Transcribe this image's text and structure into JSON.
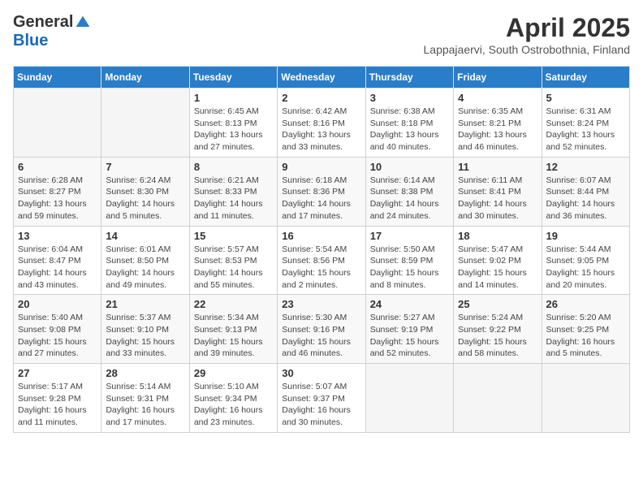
{
  "header": {
    "logo_general": "General",
    "logo_blue": "Blue",
    "month": "April 2025",
    "location": "Lappajaervi, South Ostrobothnia, Finland"
  },
  "weekdays": [
    "Sunday",
    "Monday",
    "Tuesday",
    "Wednesday",
    "Thursday",
    "Friday",
    "Saturday"
  ],
  "weeks": [
    [
      {
        "day": "",
        "info": ""
      },
      {
        "day": "",
        "info": ""
      },
      {
        "day": "1",
        "info": "Sunrise: 6:45 AM\nSunset: 8:13 PM\nDaylight: 13 hours and 27 minutes."
      },
      {
        "day": "2",
        "info": "Sunrise: 6:42 AM\nSunset: 8:16 PM\nDaylight: 13 hours and 33 minutes."
      },
      {
        "day": "3",
        "info": "Sunrise: 6:38 AM\nSunset: 8:18 PM\nDaylight: 13 hours and 40 minutes."
      },
      {
        "day": "4",
        "info": "Sunrise: 6:35 AM\nSunset: 8:21 PM\nDaylight: 13 hours and 46 minutes."
      },
      {
        "day": "5",
        "info": "Sunrise: 6:31 AM\nSunset: 8:24 PM\nDaylight: 13 hours and 52 minutes."
      }
    ],
    [
      {
        "day": "6",
        "info": "Sunrise: 6:28 AM\nSunset: 8:27 PM\nDaylight: 13 hours and 59 minutes."
      },
      {
        "day": "7",
        "info": "Sunrise: 6:24 AM\nSunset: 8:30 PM\nDaylight: 14 hours and 5 minutes."
      },
      {
        "day": "8",
        "info": "Sunrise: 6:21 AM\nSunset: 8:33 PM\nDaylight: 14 hours and 11 minutes."
      },
      {
        "day": "9",
        "info": "Sunrise: 6:18 AM\nSunset: 8:36 PM\nDaylight: 14 hours and 17 minutes."
      },
      {
        "day": "10",
        "info": "Sunrise: 6:14 AM\nSunset: 8:38 PM\nDaylight: 14 hours and 24 minutes."
      },
      {
        "day": "11",
        "info": "Sunrise: 6:11 AM\nSunset: 8:41 PM\nDaylight: 14 hours and 30 minutes."
      },
      {
        "day": "12",
        "info": "Sunrise: 6:07 AM\nSunset: 8:44 PM\nDaylight: 14 hours and 36 minutes."
      }
    ],
    [
      {
        "day": "13",
        "info": "Sunrise: 6:04 AM\nSunset: 8:47 PM\nDaylight: 14 hours and 43 minutes."
      },
      {
        "day": "14",
        "info": "Sunrise: 6:01 AM\nSunset: 8:50 PM\nDaylight: 14 hours and 49 minutes."
      },
      {
        "day": "15",
        "info": "Sunrise: 5:57 AM\nSunset: 8:53 PM\nDaylight: 14 hours and 55 minutes."
      },
      {
        "day": "16",
        "info": "Sunrise: 5:54 AM\nSunset: 8:56 PM\nDaylight: 15 hours and 2 minutes."
      },
      {
        "day": "17",
        "info": "Sunrise: 5:50 AM\nSunset: 8:59 PM\nDaylight: 15 hours and 8 minutes."
      },
      {
        "day": "18",
        "info": "Sunrise: 5:47 AM\nSunset: 9:02 PM\nDaylight: 15 hours and 14 minutes."
      },
      {
        "day": "19",
        "info": "Sunrise: 5:44 AM\nSunset: 9:05 PM\nDaylight: 15 hours and 20 minutes."
      }
    ],
    [
      {
        "day": "20",
        "info": "Sunrise: 5:40 AM\nSunset: 9:08 PM\nDaylight: 15 hours and 27 minutes."
      },
      {
        "day": "21",
        "info": "Sunrise: 5:37 AM\nSunset: 9:10 PM\nDaylight: 15 hours and 33 minutes."
      },
      {
        "day": "22",
        "info": "Sunrise: 5:34 AM\nSunset: 9:13 PM\nDaylight: 15 hours and 39 minutes."
      },
      {
        "day": "23",
        "info": "Sunrise: 5:30 AM\nSunset: 9:16 PM\nDaylight: 15 hours and 46 minutes."
      },
      {
        "day": "24",
        "info": "Sunrise: 5:27 AM\nSunset: 9:19 PM\nDaylight: 15 hours and 52 minutes."
      },
      {
        "day": "25",
        "info": "Sunrise: 5:24 AM\nSunset: 9:22 PM\nDaylight: 15 hours and 58 minutes."
      },
      {
        "day": "26",
        "info": "Sunrise: 5:20 AM\nSunset: 9:25 PM\nDaylight: 16 hours and 5 minutes."
      }
    ],
    [
      {
        "day": "27",
        "info": "Sunrise: 5:17 AM\nSunset: 9:28 PM\nDaylight: 16 hours and 11 minutes."
      },
      {
        "day": "28",
        "info": "Sunrise: 5:14 AM\nSunset: 9:31 PM\nDaylight: 16 hours and 17 minutes."
      },
      {
        "day": "29",
        "info": "Sunrise: 5:10 AM\nSunset: 9:34 PM\nDaylight: 16 hours and 23 minutes."
      },
      {
        "day": "30",
        "info": "Sunrise: 5:07 AM\nSunset: 9:37 PM\nDaylight: 16 hours and 30 minutes."
      },
      {
        "day": "",
        "info": ""
      },
      {
        "day": "",
        "info": ""
      },
      {
        "day": "",
        "info": ""
      }
    ]
  ]
}
